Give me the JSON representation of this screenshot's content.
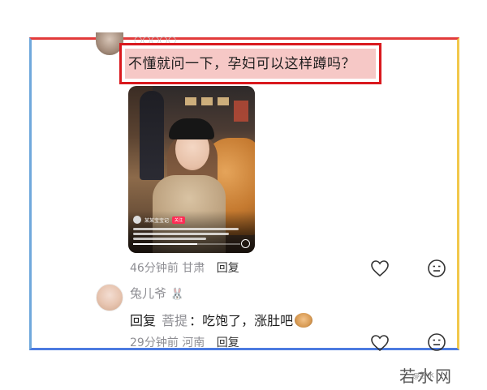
{
  "top_comment": {
    "text": "不懂就问一下，孕妇可以这样蹲吗？",
    "username_partial": "○○○○○",
    "video": {
      "channel": "某某宝宝记",
      "badge": "关注",
      "progress": 0.6
    },
    "time": "46分钟前",
    "location": "甘肃",
    "reply_label": "回复"
  },
  "reply_comment": {
    "username": "兔儿爷",
    "username_emoji": "🐰",
    "reply_prefix": "回复",
    "reply_target": "菩提",
    "text": "：吃饱了，涨肚吧",
    "time": "29分钟前",
    "location": "河南",
    "reply_label": "回复"
  },
  "watermark": {
    "big": "若水网",
    "small": "@若水"
  },
  "colors": {
    "highlight_border": "#d9191e",
    "highlight_fill": "#f6c8c6",
    "frame_top": "#e23b3b",
    "frame_left": "#6fa8dc",
    "frame_right": "#f2c84b",
    "frame_bottom": "#4c7be0"
  }
}
